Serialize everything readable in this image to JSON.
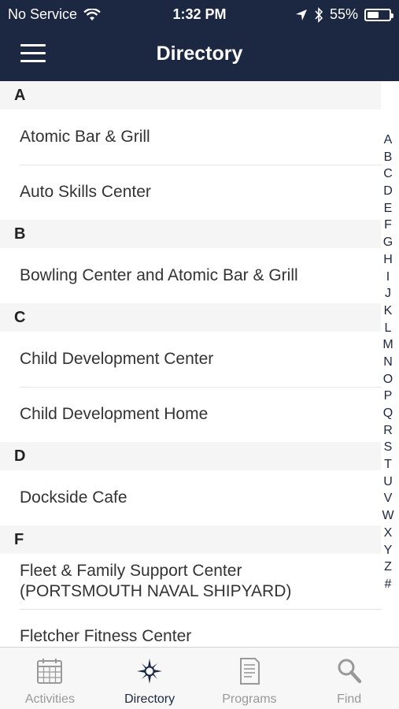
{
  "status_bar": {
    "carrier": "No Service",
    "time": "1:32 PM",
    "battery_percent": "55%",
    "battery_level": 0.55
  },
  "nav": {
    "title": "Directory",
    "menu_icon": "hamburger-menu-icon"
  },
  "sections": [
    {
      "letter": "A",
      "items": [
        "Atomic Bar & Grill",
        "Auto Skills Center"
      ]
    },
    {
      "letter": "B",
      "items": [
        "Bowling Center and Atomic Bar & Grill"
      ]
    },
    {
      "letter": "C",
      "items": [
        "Child Development Center",
        "Child Development Home"
      ]
    },
    {
      "letter": "D",
      "items": [
        "Dockside Cafe"
      ]
    },
    {
      "letter": "F",
      "items": [
        "Fleet & Family Support Center\n(PORTSMOUTH NAVAL SHIPYARD)",
        "Fletcher Fitness Center"
      ]
    }
  ],
  "index_letters": [
    "A",
    "B",
    "C",
    "D",
    "E",
    "F",
    "G",
    "H",
    "I",
    "J",
    "K",
    "L",
    "M",
    "N",
    "O",
    "P",
    "Q",
    "R",
    "S",
    "T",
    "U",
    "V",
    "W",
    "X",
    "Y",
    "Z",
    "#"
  ],
  "tabs": [
    {
      "label": "Activities",
      "icon": "calendar-icon",
      "active": false
    },
    {
      "label": "Directory",
      "icon": "compass-icon",
      "active": true
    },
    {
      "label": "Programs",
      "icon": "document-icon",
      "active": false
    },
    {
      "label": "Find",
      "icon": "search-icon",
      "active": false
    }
  ],
  "colors": {
    "header_bg": "#1c2742",
    "section_bg": "#f5f5f5",
    "tab_inactive": "#999999",
    "tab_active": "#1c2742"
  }
}
